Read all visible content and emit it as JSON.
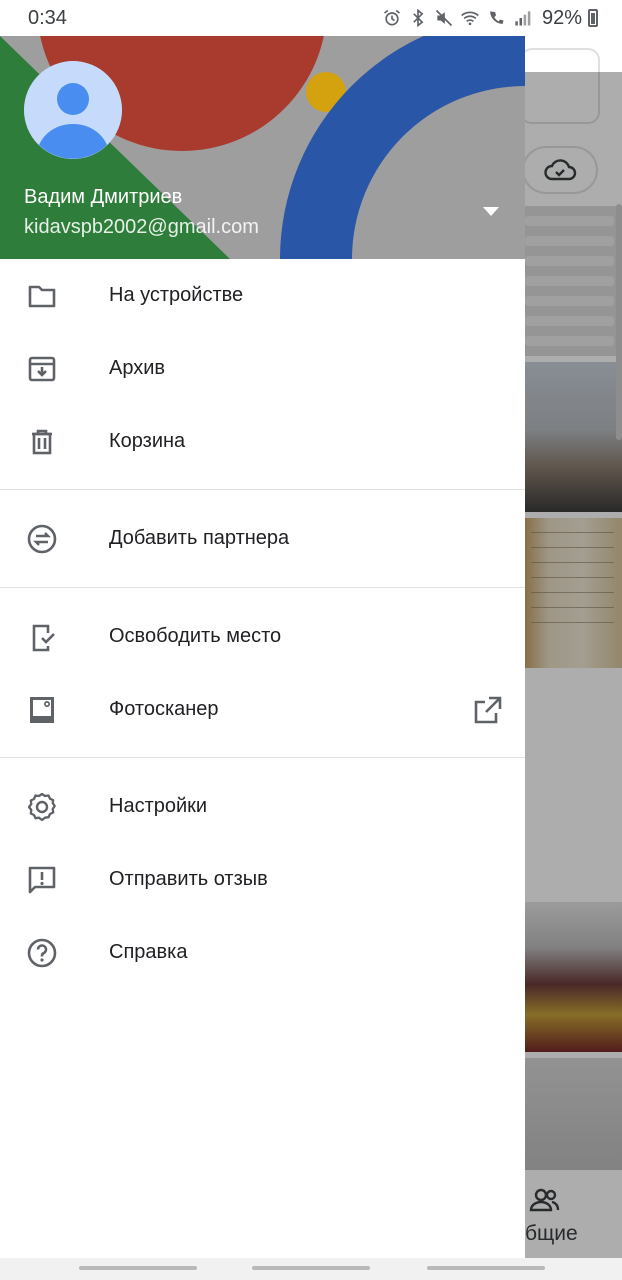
{
  "status_bar": {
    "time": "0:34",
    "battery": "92%",
    "icons": [
      "alarm-icon",
      "bluetooth-icon",
      "mute-icon",
      "wifi-icon",
      "wifi-calling-icon",
      "signal-icon",
      "battery-icon"
    ]
  },
  "account": {
    "name": "Вадим Дмитриев",
    "email": "kidavspb2002@gmail.com"
  },
  "menu": {
    "on_device": "На устройстве",
    "archive": "Архив",
    "trash": "Корзина",
    "add_partner": "Добавить партнера",
    "free_up_space": "Освободить место",
    "photoscan": "Фотосканер",
    "settings": "Настройки",
    "send_feedback": "Отправить отзыв",
    "help": "Справка"
  },
  "background": {
    "bottom_nav_label": "бщие"
  },
  "colors": {
    "header_red": "#a83a2e",
    "header_green": "#2e7d3a",
    "header_blue": "#2a56a8",
    "header_yellow": "#d4a20f",
    "header_gray": "#9e9e9e",
    "icon_gray": "#5f6368"
  }
}
